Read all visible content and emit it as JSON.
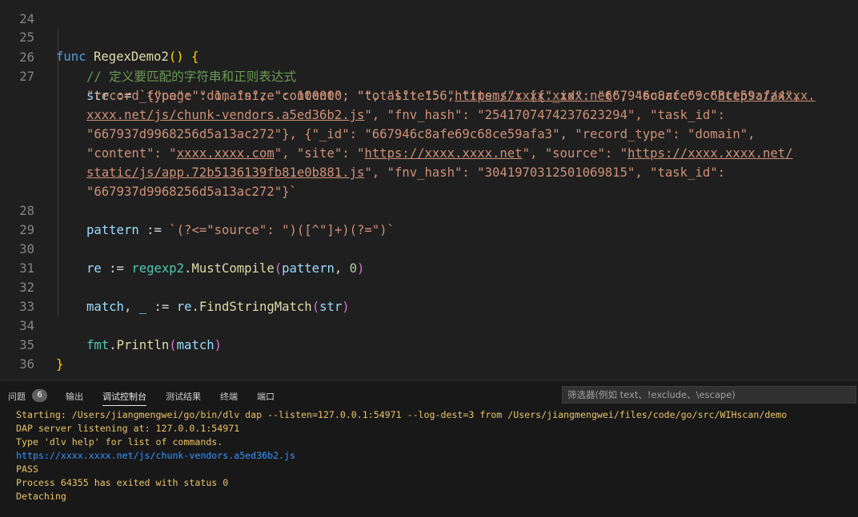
{
  "editor": {
    "line_numbers": [
      "24",
      "25",
      "26",
      "27",
      "28",
      "29",
      "30",
      "31",
      "32",
      "33",
      "34",
      "35",
      "36"
    ],
    "func_keyword": "func",
    "func_name": "RegexDemo2",
    "open_paren": "(",
    "close_paren": ")",
    "open_brace": "{",
    "close_brace": "}",
    "comment": "// 定义要匹配的字符串和正则表达式",
    "str_var": "str",
    "assign_op": ":=",
    "str_literal_lines": [
      "`{\"page\": 1, \"size\": 100000, \"total\": 156, \"items\": [{\"_id\": \"667946c8afe69c68ce59afa4\",",
      "\"record_type\": \"domain\", \"content\": \"\", \"site\": \"",
      "https://xxxx.xxxx.net",
      "\", \"source\": \"",
      "https://xxxx.",
      "xxxx.net/js/chunk-vendors.a5ed36b2.js",
      "\", \"fnv_hash\": \"2541707474237623294\", \"task_id\":",
      "\"667937d9968256d5a13ac272\"}, {\"_id\": \"667946c8afe69c68ce59afa3\", \"record_type\": \"domain\",",
      "\"content\": \"",
      "xxxx.xxxx.com",
      "\", \"site\": \"",
      "https://xxxx.xxxx.net",
      "\", \"source\": \"",
      "https://xxxx.xxxx.net/",
      "static/js/app.72b5136139fb81e0b881.js",
      "\", \"fnv_hash\": \"3041970312501069815\", \"task_id\":",
      "\"667937d9968256d5a13ac272\"}`"
    ],
    "pattern_var": "pattern",
    "pattern_literal": "`(?<=\"source\": \")([^\"]+)(?=\")`",
    "re_var": "re",
    "pkg_name": "regexp2",
    "dot": ".",
    "compile_fn": "MustCompile",
    "comma": ",",
    "zero": "0",
    "match_var": "match",
    "underscore": "_",
    "find_fn": "FindStringMatch",
    "fmt_pkg": "fmt",
    "println_fn": "Println"
  },
  "panel": {
    "tabs": {
      "problems": "问题",
      "problems_count": "6",
      "output": "输出",
      "debug_console": "调试控制台",
      "test_results": "测试结果",
      "terminal": "终端",
      "ports": "端口"
    },
    "filter_placeholder": "筛选器(例如 text、!exclude、\\escape)",
    "console_lines": [
      "Starting: /Users/jiangmengwei/go/bin/dlv dap --listen=127.0.0.1:54971 --log-dest=3 from /Users/jiangmengwei/files/code/go/src/WIHscan/demo",
      "DAP server listening at: 127.0.0.1:54971",
      "Type 'dlv help' for list of commands.",
      "https://xxxx.xxxx.net/js/chunk-vendors.a5ed36b2.js",
      "PASS",
      "Process 64355 has exited with status 0",
      "Detaching"
    ]
  },
  "colors": {
    "editor_bg": "#1f1f1f",
    "panel_bg": "#181818",
    "console_text": "#e9c46a",
    "console_link": "#3794ff"
  }
}
